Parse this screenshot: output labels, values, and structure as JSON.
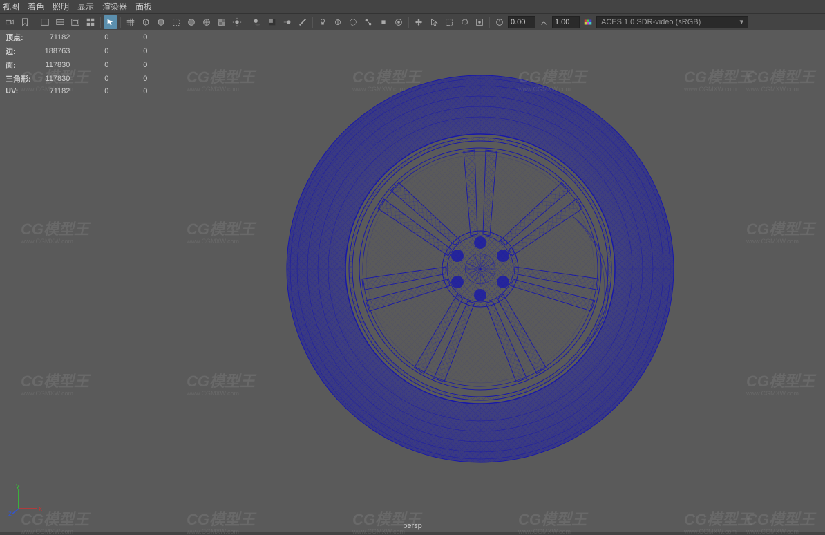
{
  "menubar": {
    "items": [
      "视图",
      "着色",
      "照明",
      "显示",
      "渲染器",
      "面板"
    ]
  },
  "toolbar": {
    "value1": "0.00",
    "value2": "1.00",
    "color_space": "ACES 1.0 SDR-video (sRGB)"
  },
  "stats": {
    "rows": [
      {
        "label": "顶点:",
        "v1": "71182",
        "v2": "0",
        "v3": "0"
      },
      {
        "label": "边:",
        "v1": "188763",
        "v2": "0",
        "v3": "0"
      },
      {
        "label": "面:",
        "v1": "117830",
        "v2": "0",
        "v3": "0"
      },
      {
        "label": "三角形:",
        "v1": "117830",
        "v2": "0",
        "v3": "0"
      },
      {
        "label": "UV:",
        "v1": "71182",
        "v2": "0",
        "v3": "0"
      }
    ]
  },
  "viewport": {
    "camera_label": "persp",
    "axis": {
      "x": "x",
      "y": "y",
      "z": "z"
    }
  },
  "watermark": {
    "brand": "CG模型王",
    "url": "www.CGMXW.com"
  }
}
